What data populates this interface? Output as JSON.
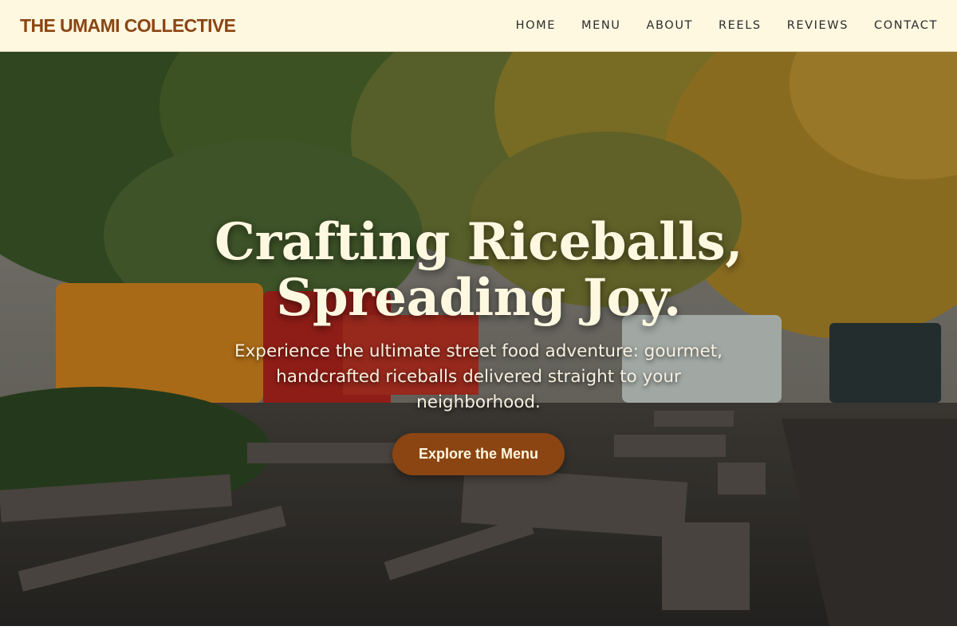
{
  "header": {
    "brand": "THE UMAMI COLLECTIVE",
    "nav": [
      {
        "label": "HOME"
      },
      {
        "label": "MENU"
      },
      {
        "label": "ABOUT"
      },
      {
        "label": "REELS"
      },
      {
        "label": "REVIEWS"
      },
      {
        "label": "CONTACT"
      }
    ]
  },
  "hero": {
    "title_line1": "Crafting Riceballs,",
    "title_line2": "Spreading Joy.",
    "subtitle": "Experience the ultimate street food adventure: gourmet, handcrafted riceballs delivered straight to your neighborhood.",
    "cta_label": "Explore the Menu"
  },
  "colors": {
    "header_bg": "#fff8e1",
    "brand": "#8b4513",
    "cta_bg": "#8b4513",
    "hero_text": "#fff8e1"
  }
}
